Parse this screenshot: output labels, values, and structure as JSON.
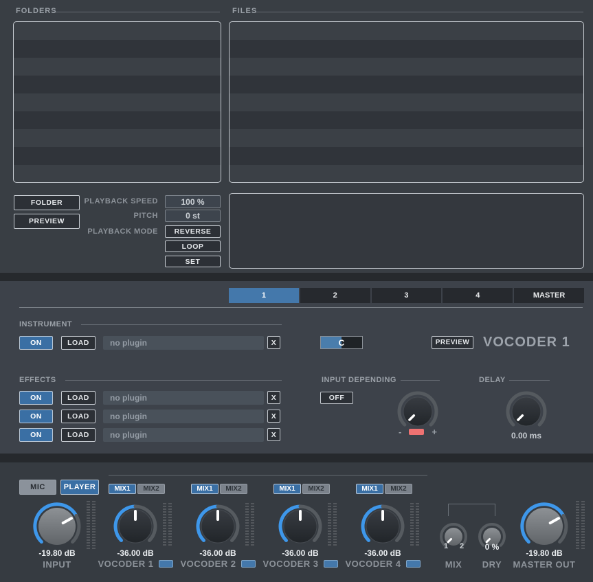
{
  "browser": {
    "folders_label": "FOLDERS",
    "files_label": "FILES",
    "folder_button": "FOLDER",
    "preview_button": "PREVIEW",
    "playback_speed_label": "PLAYBACK SPEED",
    "playback_speed_value": "100 %",
    "pitch_label": "PITCH",
    "pitch_value": "0 st",
    "playback_mode_label": "PLAYBACK MODE",
    "reverse_button": "REVERSE",
    "loop_button": "LOOP",
    "set_button": "SET"
  },
  "tabs": {
    "items": [
      "1",
      "2",
      "3",
      "4",
      "MASTER"
    ],
    "active": "1"
  },
  "instrument": {
    "header": "INSTRUMENT",
    "on_button": "ON",
    "load_button": "LOAD",
    "plugin_name": "no plugin",
    "clear_button": "X",
    "key_value": "C",
    "preview_button": "PREVIEW",
    "title": "VOCODER 1"
  },
  "effects": {
    "header": "EFFECTS",
    "rows": [
      {
        "on_button": "ON",
        "load_button": "LOAD",
        "plugin_name": "no plugin",
        "clear_button": "X"
      },
      {
        "on_button": "ON",
        "load_button": "LOAD",
        "plugin_name": "no plugin",
        "clear_button": "X"
      },
      {
        "on_button": "ON",
        "load_button": "LOAD",
        "plugin_name": "no plugin",
        "clear_button": "X"
      }
    ]
  },
  "input_depending": {
    "header": "INPUT DEPENDING",
    "off_button": "OFF",
    "minus": "-",
    "plus": "+"
  },
  "delay": {
    "header": "DELAY",
    "value": "0.00 ms"
  },
  "mixer": {
    "mic_button": "MIC",
    "player_button": "PLAYER",
    "input": {
      "value": "-19.80 dB",
      "label": "INPUT"
    },
    "vocoders": [
      {
        "mix1": "MIX1",
        "mix2": "MIX2",
        "value": "-36.00 dB",
        "label": "VOCODER 1"
      },
      {
        "mix1": "MIX1",
        "mix2": "MIX2",
        "value": "-36.00 dB",
        "label": "VOCODER 2"
      },
      {
        "mix1": "MIX1",
        "mix2": "MIX2",
        "value": "-36.00 dB",
        "label": "VOCODER 3"
      },
      {
        "mix1": "MIX1",
        "mix2": "MIX2",
        "value": "-36.00 dB",
        "label": "VOCODER 4"
      }
    ],
    "mix": {
      "num1": "1",
      "num2": "2",
      "label": "MIX"
    },
    "dry": {
      "value": "0 %",
      "label": "DRY"
    },
    "master": {
      "value": "-19.80 dB",
      "label": "MASTER OUT"
    }
  },
  "colors": {
    "accent_blue": "#4478ab",
    "button_blue": "#3a6fa4",
    "knob_arc_blue": "#3e97ea",
    "marker_red": "#ee7272",
    "mic_gray": "#8b929b"
  }
}
